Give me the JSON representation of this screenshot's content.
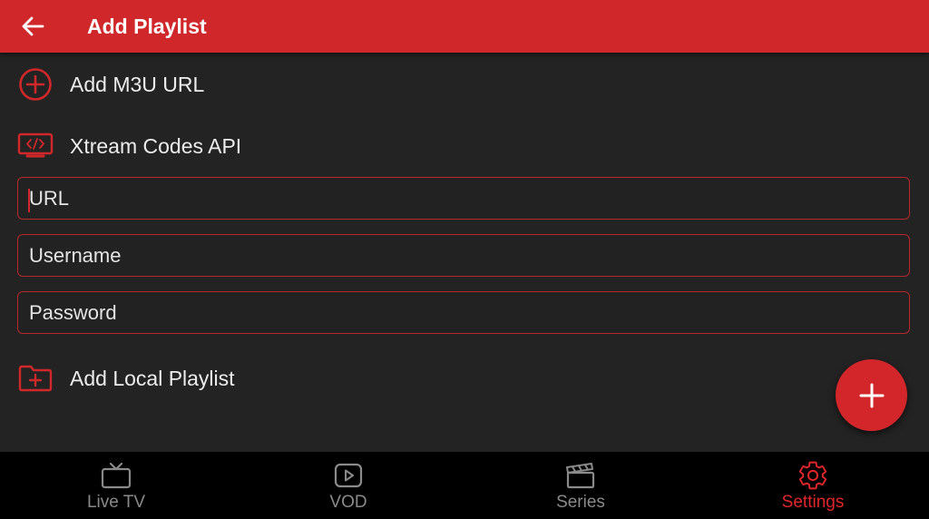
{
  "header": {
    "title": "Add Playlist",
    "back_icon": "arrow-left-icon",
    "background": "#d0282a"
  },
  "options": {
    "m3u_label": "Add M3U URL",
    "xtream_label": "Xtream Codes API",
    "local_label": "Add Local Playlist"
  },
  "form": {
    "url_placeholder": "URL",
    "username_placeholder": "Username",
    "password_placeholder": "Password"
  },
  "fab": {
    "icon": "plus-icon",
    "color": "#d3262a"
  },
  "bottom_nav": {
    "items": [
      {
        "label": "Live TV",
        "icon": "tv-icon"
      },
      {
        "label": "VOD",
        "icon": "play-icon"
      },
      {
        "label": "Series",
        "icon": "clapperboard-icon"
      },
      {
        "label": "Settings",
        "icon": "gear-icon"
      }
    ],
    "active": "Settings",
    "active_color": "#e0262a",
    "inactive_color": "#8a8a8a"
  },
  "colors": {
    "accent": "#d0282a",
    "background": "#232323"
  }
}
